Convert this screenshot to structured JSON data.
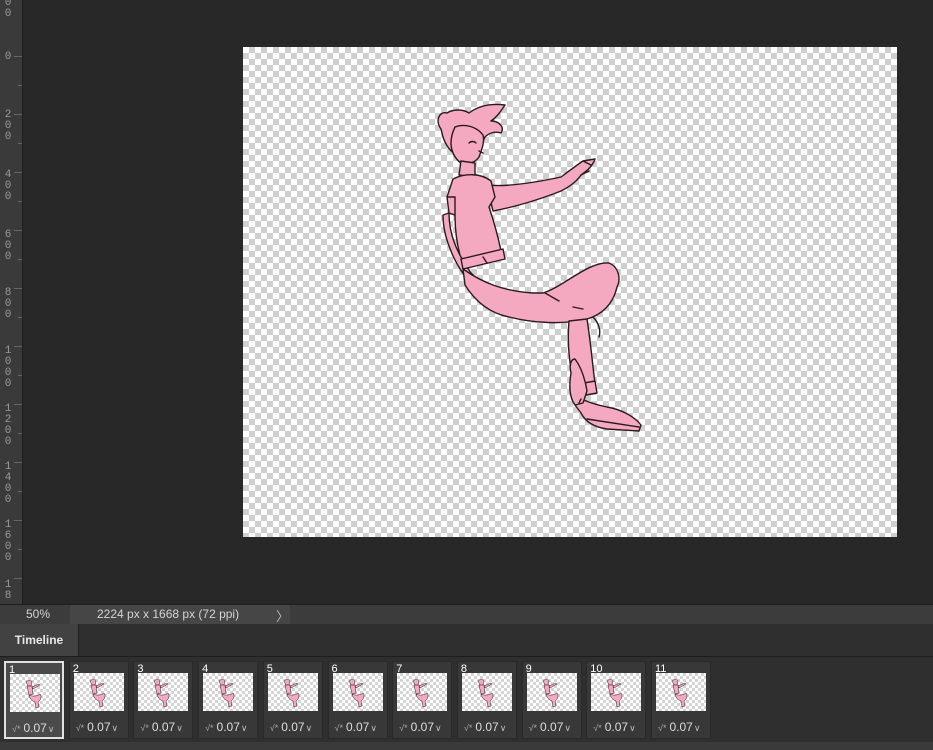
{
  "ruler": {
    "labels": [
      "0",
      "200",
      "400",
      "600",
      "800",
      "1000",
      "1200",
      "1400",
      "1600",
      "18"
    ],
    "top_partial": "00"
  },
  "status": {
    "zoom": "50%",
    "doc_info": "2224 px x 1668 px (72 ppi)",
    "arrow": "〉"
  },
  "timeline": {
    "tab": "Timeline",
    "frames": [
      {
        "num": "1",
        "delay": "0.07"
      },
      {
        "num": "2",
        "delay": "0.07"
      },
      {
        "num": "3",
        "delay": "0.07"
      },
      {
        "num": "4",
        "delay": "0.07"
      },
      {
        "num": "5",
        "delay": "0.07"
      },
      {
        "num": "6",
        "delay": "0.07"
      },
      {
        "num": "7",
        "delay": "0.07"
      },
      {
        "num": "8",
        "delay": "0.07"
      },
      {
        "num": "9",
        "delay": "0.07"
      },
      {
        "num": "10",
        "delay": "0.07"
      },
      {
        "num": "11",
        "delay": "0.07"
      }
    ],
    "selected_frame": "1"
  },
  "colors": {
    "figure_fill": "#f5a9c0",
    "figure_stroke": "#2b1a20"
  }
}
